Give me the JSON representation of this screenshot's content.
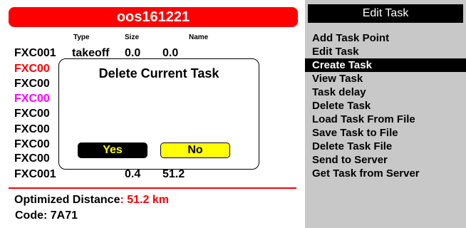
{
  "task": {
    "title": "oos161221",
    "columns": {
      "type": "Type",
      "size": "Size",
      "name": "Name"
    },
    "rows": [
      {
        "id": "FXC001",
        "type": "takeoff",
        "size": "0.0",
        "name": "0.0",
        "color": "#000000"
      },
      {
        "id": "FXC00",
        "type": "",
        "size": "",
        "name": "",
        "color": "#ff0000"
      },
      {
        "id": "FXC00",
        "type": "",
        "size": "",
        "name": "",
        "color": "#000000"
      },
      {
        "id": "FXC00",
        "type": "",
        "size": "",
        "name": "",
        "color": "#ff00ff"
      },
      {
        "id": "FXC00",
        "type": "",
        "size": "",
        "name": "",
        "color": "#000000"
      },
      {
        "id": "FXC00",
        "type": "",
        "size": "",
        "name": "",
        "color": "#000000"
      },
      {
        "id": "FXC00",
        "type": "",
        "size": "",
        "name": "",
        "color": "#000000"
      },
      {
        "id": "FXC00",
        "type": "",
        "size": "",
        "name": "",
        "color": "#000000"
      },
      {
        "id": "FXC001",
        "type": "",
        "size": "0.4",
        "name": "51.2",
        "color": "#000000"
      }
    ],
    "optimized_label": "Optimized Distance",
    "optimized_colon": ":",
    "optimized_value": "51.2 km",
    "code_text": "Code: 7A71"
  },
  "dialog": {
    "title": "Delete Current Task",
    "yes_label": "Yes",
    "no_label": "No"
  },
  "menu": {
    "header": "Edit Task",
    "items": [
      {
        "label": "Add Task Point",
        "selected": false
      },
      {
        "label": "Edit Task",
        "selected": false
      },
      {
        "label": "Create Task",
        "selected": true
      },
      {
        "label": "View Task",
        "selected": false
      },
      {
        "label": "Task delay",
        "selected": false
      },
      {
        "label": "Delete Task",
        "selected": false
      },
      {
        "label": "Load Task From File",
        "selected": false
      },
      {
        "label": "Save Task to File",
        "selected": false
      },
      {
        "label": "Delete Task File",
        "selected": false
      },
      {
        "label": "Send to Server",
        "selected": false
      },
      {
        "label": "Get Task from Server",
        "selected": false
      }
    ]
  },
  "colors": {
    "accent_red": "#ff0000",
    "yes_button_bg": "#000000",
    "yes_button_text": "#ffff00",
    "no_button_bg": "#ffff00",
    "menu_bg": "#c8c8c8"
  }
}
